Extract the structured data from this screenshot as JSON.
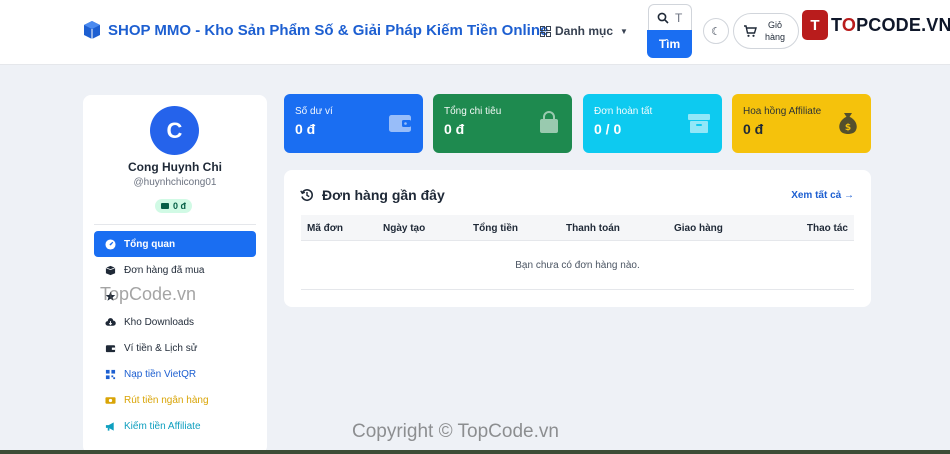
{
  "header": {
    "brand": "SHOP MMO - Kho Sản Phẩm Số & Giải Pháp Kiếm Tiền Online",
    "menu_label": "Danh mục",
    "search_placeholder": "T",
    "search_button": "Tìm",
    "cart_label_line1": "Giỏ",
    "cart_label_line2": "hàng",
    "watermark_logo_mark": "T",
    "watermark_logo_text_a": "T",
    "watermark_logo_text_o": "O",
    "watermark_logo_text_b": "PCODE.VN"
  },
  "profile": {
    "avatar_initial": "C",
    "name": "Cong Huynh Chi",
    "handle": "@huynhchicong01",
    "balance": "0 đ"
  },
  "sidebar": {
    "items": [
      {
        "label": "Tổng quan",
        "icon": "gauge-icon",
        "active": true
      },
      {
        "label": "Đơn hàng đã mua",
        "icon": "box-icon"
      },
      {
        "label": "",
        "icon": "star-icon"
      },
      {
        "label": "Kho Downloads",
        "icon": "cloud-download-icon"
      },
      {
        "label": "Ví tiền & Lịch sử",
        "icon": "wallet-icon"
      },
      {
        "label": "Nạp tiền VietQR",
        "icon": "qr-icon"
      },
      {
        "label": "Rút tiền ngân hàng",
        "icon": "money-icon"
      },
      {
        "label": "Kiếm tiền Affiliate",
        "icon": "megaphone-icon"
      }
    ]
  },
  "stats": {
    "wallet": {
      "label": "Số dư ví",
      "value": "0 đ"
    },
    "spent": {
      "label": "Tổng chi tiêu",
      "value": "0 đ"
    },
    "completed": {
      "label": "Đơn hoàn tất",
      "value": "0 / 0"
    },
    "affiliate": {
      "label": "Hoa hồng Affiliate",
      "value": "0 đ"
    }
  },
  "orders": {
    "title": "Đơn hàng gần đây",
    "view_all": "Xem tất cả →",
    "columns": [
      "Mã đơn",
      "Ngày tạo",
      "Tổng tiền",
      "Thanh toán",
      "Giao hàng",
      "Thao tác"
    ],
    "empty_text": "Bạn chưa có đơn hàng nào."
  },
  "watermarks": {
    "side": "TopCode.vn",
    "bottom": "Copyright © TopCode.vn"
  },
  "colors": {
    "primary": "#1a6ef2",
    "success": "#1e8a4f",
    "info": "#0dcaf0",
    "warning": "#f5c20c"
  }
}
